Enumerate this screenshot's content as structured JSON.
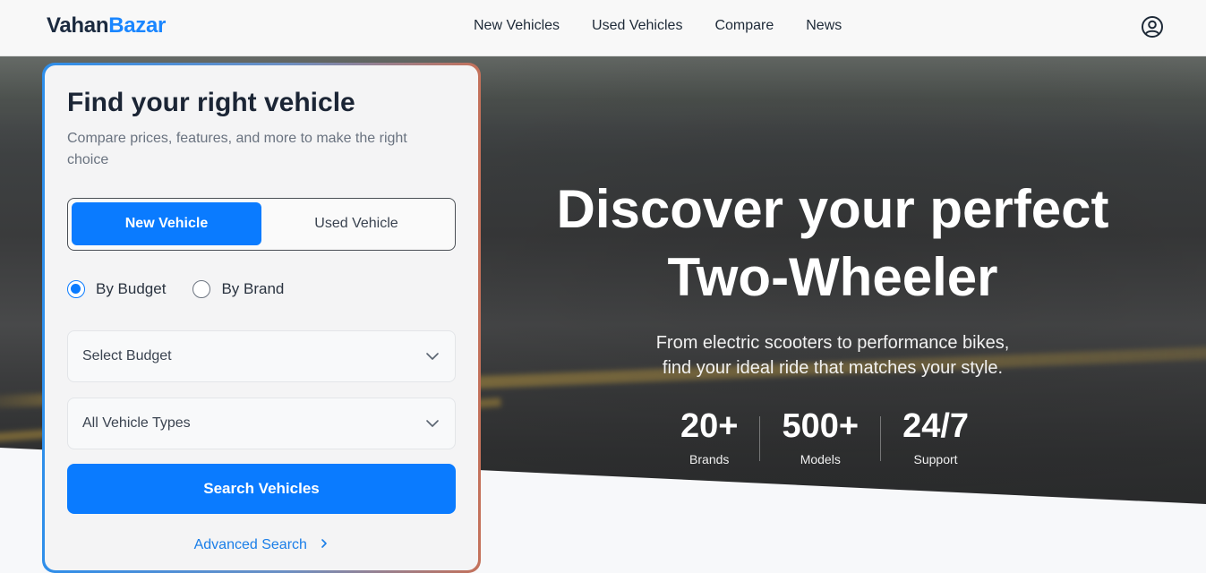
{
  "nav": {
    "logo_part1": "Vahan",
    "logo_part2": "Bazar",
    "links": [
      "New Vehicles",
      "Used Vehicles",
      "Compare",
      "News"
    ],
    "account_icon": "user-circle-icon"
  },
  "hero": {
    "title_line1": "Discover your perfect",
    "title_line2": "Two-Wheeler",
    "subtitle_line1": "From electric scooters to performance bikes,",
    "subtitle_line2": "find your ideal ride that matches your style.",
    "stats": [
      {
        "value": "20+",
        "label": "Brands"
      },
      {
        "value": "500+",
        "label": "Models"
      },
      {
        "value": "24/7",
        "label": "Support"
      }
    ]
  },
  "finder": {
    "title": "Find your right vehicle",
    "description": "Compare prices, features, and more to make the right choice",
    "tabs": [
      {
        "label": "New Vehicle",
        "selected": true
      },
      {
        "label": "Used Vehicle",
        "selected": false
      }
    ],
    "radios": [
      {
        "label": "By Budget",
        "checked": true
      },
      {
        "label": "By Brand",
        "checked": false
      }
    ],
    "budget_select": "Select Budget",
    "type_select": "All Vehicle Types",
    "search_button": "Search Vehicles",
    "advanced_link": "Advanced Search",
    "advanced_icon": "chevron-right-icon"
  },
  "colors": {
    "accent": "#0a7bff",
    "logo_dark": "#1b2a3f",
    "logo_blue": "#1a86ff"
  }
}
